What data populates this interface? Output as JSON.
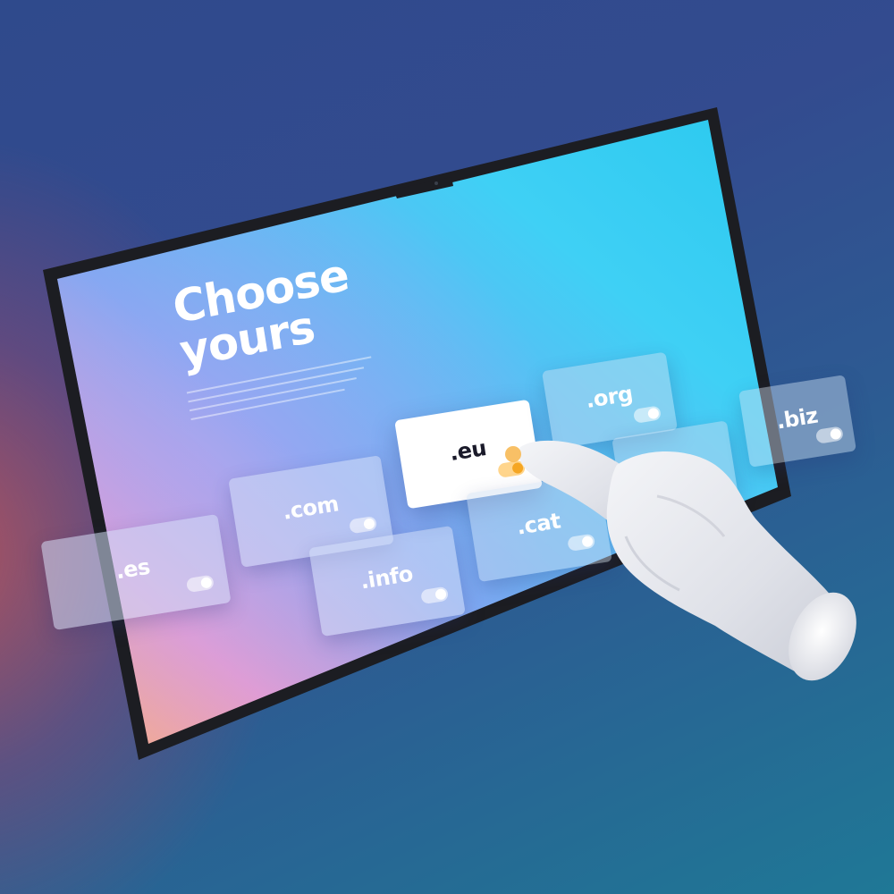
{
  "screen": {
    "headline_line1": "Choose",
    "headline_line2": "yours"
  },
  "domains": [
    {
      "label": ".es",
      "state": "off"
    },
    {
      "label": ".com",
      "state": "off"
    },
    {
      "label": ".info",
      "state": "off"
    },
    {
      "label": ".eu",
      "state": "selected"
    },
    {
      "label": ".cat",
      "state": "off"
    },
    {
      "label": ".org",
      "state": "off"
    },
    {
      "label": ".biz",
      "state": "off"
    }
  ],
  "colors": {
    "screen_gradient_start": "#f6a9c9",
    "screen_gradient_mid": "#5fb4f6",
    "screen_gradient_end": "#2fd6f5",
    "background_accent": "#c45456",
    "background_main": "#2f4a8c",
    "selected_toggle": "#f5a623"
  },
  "icons": {
    "pointer": "hand-pointing-icon"
  }
}
